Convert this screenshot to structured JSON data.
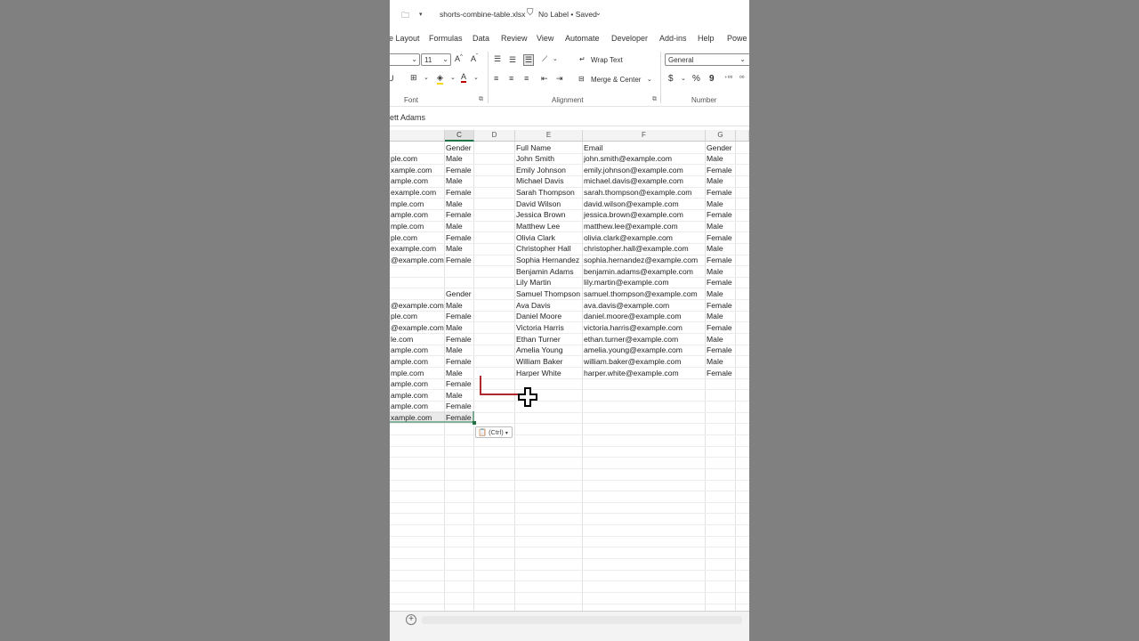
{
  "titlebar": {
    "file_name": "shorts-combine-table.xlsx",
    "label_status": "No Label • Saved"
  },
  "menu": {
    "tabs": [
      "e Layout",
      "Formulas",
      "Data",
      "Review",
      "View",
      "Automate",
      "Developer",
      "Add-ins",
      "Help",
      "Powe"
    ]
  },
  "ribbon": {
    "font_size": "11",
    "wrap_text": "Wrap Text",
    "merge_center": "Merge & Center",
    "number_format": "General",
    "currency_symbol": "$",
    "percent_symbol": "%",
    "comma_symbol": "9",
    "groups": {
      "font": "Font",
      "alignment": "Alignment",
      "number": "Number"
    }
  },
  "formula_bar": {
    "text": "ett Adams"
  },
  "grid": {
    "column_headers": [
      "C",
      "D",
      "E",
      "F",
      "G"
    ],
    "left_rows": [
      {
        "b": "",
        "c": "Gender"
      },
      {
        "b": "ple.com",
        "c": "Male"
      },
      {
        "b": "xample.com",
        "c": "Female"
      },
      {
        "b": "ample.com",
        "c": "Male"
      },
      {
        "b": "example.com",
        "c": "Female"
      },
      {
        "b": "mple.com",
        "c": "Male"
      },
      {
        "b": "ample.com",
        "c": "Female"
      },
      {
        "b": "mple.com",
        "c": "Male"
      },
      {
        "b": "ple.com",
        "c": "Female"
      },
      {
        "b": "example.com",
        "c": "Male"
      },
      {
        "b": "@example.com",
        "c": "Female"
      },
      {
        "b": "",
        "c": ""
      },
      {
        "b": "",
        "c": ""
      },
      {
        "b": "",
        "c": "Gender"
      },
      {
        "b": "@example.com",
        "c": "Male"
      },
      {
        "b": "ple.com",
        "c": "Female"
      },
      {
        "b": "@example.com",
        "c": "Male"
      },
      {
        "b": "le.com",
        "c": "Female"
      },
      {
        "b": "ample.com",
        "c": "Male"
      },
      {
        "b": "ample.com",
        "c": "Female"
      },
      {
        "b": "mple.com",
        "c": "Male"
      },
      {
        "b": "ample.com",
        "c": "Female"
      },
      {
        "b": "ample.com",
        "c": "Male"
      },
      {
        "b": "ample.com",
        "c": "Female"
      },
      {
        "b": "xample.com",
        "c": "Female"
      }
    ],
    "right_rows": [
      {
        "e": "Full Name",
        "f": "Email",
        "g": "Gender"
      },
      {
        "e": "John Smith",
        "f": "john.smith@example.com",
        "g": "Male"
      },
      {
        "e": "Emily Johnson",
        "f": "emily.johnson@example.com",
        "g": "Female"
      },
      {
        "e": "Michael Davis",
        "f": "michael.davis@example.com",
        "g": "Male"
      },
      {
        "e": "Sarah Thompson",
        "f": "sarah.thompson@example.com",
        "g": "Female"
      },
      {
        "e": "David Wilson",
        "f": "david.wilson@example.com",
        "g": "Male"
      },
      {
        "e": "Jessica Brown",
        "f": "jessica.brown@example.com",
        "g": "Female"
      },
      {
        "e": "Matthew Lee",
        "f": "matthew.lee@example.com",
        "g": "Male"
      },
      {
        "e": "Olivia Clark",
        "f": "olivia.clark@example.com",
        "g": "Female"
      },
      {
        "e": "Christopher Hall",
        "f": "christopher.hall@example.com",
        "g": "Male"
      },
      {
        "e": "Sophia Hernandez",
        "f": "sophia.hernandez@example.com",
        "g": "Female"
      },
      {
        "e": "Benjamin Adams",
        "f": "benjamin.adams@example.com",
        "g": "Male"
      },
      {
        "e": "Lily Martin",
        "f": "lily.martin@example.com",
        "g": "Female"
      },
      {
        "e": "Samuel Thompson",
        "f": "samuel.thompson@example.com",
        "g": "Male"
      },
      {
        "e": "Ava Davis",
        "f": "ava.davis@example.com",
        "g": "Female"
      },
      {
        "e": "Daniel Moore",
        "f": "daniel.moore@example.com",
        "g": "Male"
      },
      {
        "e": "Victoria Harris",
        "f": "victoria.harris@example.com",
        "g": "Female"
      },
      {
        "e": "Ethan Turner",
        "f": "ethan.turner@example.com",
        "g": "Male"
      },
      {
        "e": "Amelia Young",
        "f": "amelia.young@example.com",
        "g": "Female"
      },
      {
        "e": "William Baker",
        "f": "william.baker@example.com",
        "g": "Male"
      },
      {
        "e": "Harper White",
        "f": "harper.white@example.com",
        "g": "Female"
      }
    ]
  },
  "paste_options": {
    "label": "(Ctrl)"
  }
}
